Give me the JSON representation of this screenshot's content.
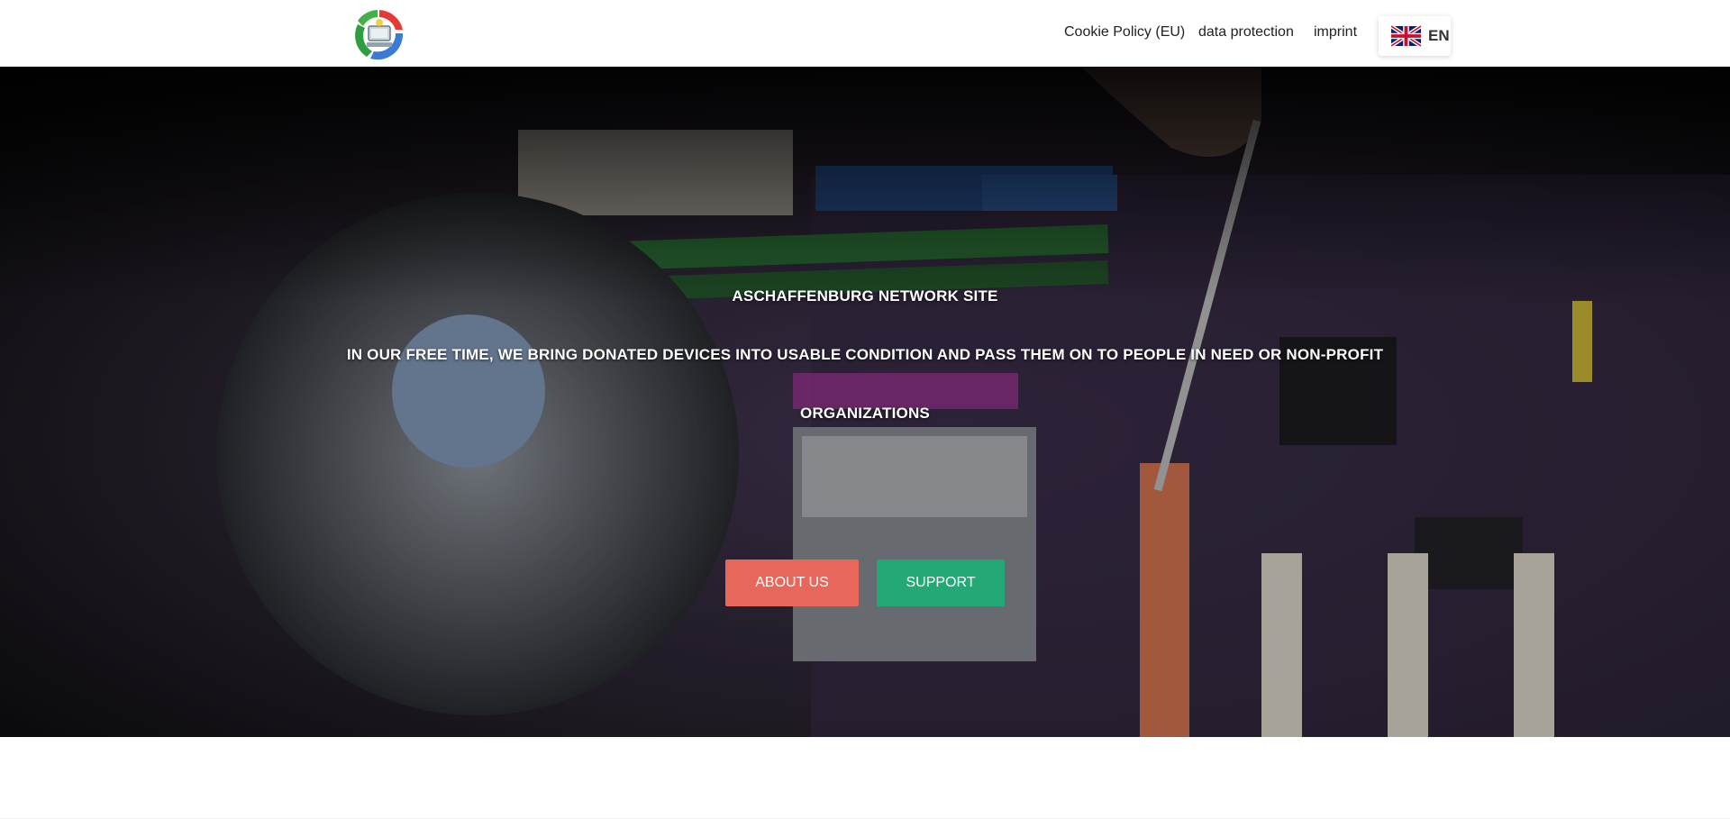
{
  "header": {
    "logo": {
      "icon": "recycle-computer-logo",
      "colors": [
        "#2e9e3f",
        "#e53935",
        "#3a7bd5",
        "#f4d03f"
      ]
    },
    "nav": [
      {
        "label": "Cookie Policy (EU)"
      },
      {
        "label": "data protection"
      },
      {
        "label": "imprint"
      }
    ],
    "language": {
      "code": "EN",
      "flag_icon": "uk-flag-icon"
    }
  },
  "hero": {
    "title": "ASCHAFFENBURG NETWORK SITE",
    "line1": "IN OUR FREE TIME, WE BRING DONATED DEVICES INTO USABLE CONDITION AND PASS THEM ON TO PEOPLE IN NEED OR NON-PROFIT",
    "line2": "ORGANIZATIONS",
    "buttons": {
      "about": {
        "label": "ABOUT US",
        "color": "#e8675b"
      },
      "support": {
        "label": "SUPPORT",
        "color": "#23a876"
      }
    }
  }
}
